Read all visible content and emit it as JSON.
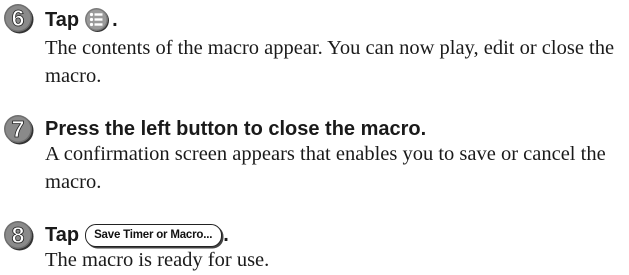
{
  "steps": [
    {
      "number": "6",
      "title_prefix": "Tap",
      "icon": "list-menu-icon",
      "title_suffix": ".",
      "description": "The contents of the macro appear. You can now play, edit or close the macro."
    },
    {
      "number": "7",
      "title": "Press the left button to close the macro.",
      "description": "A confirmation screen appears that enables you to save or cancel the macro."
    },
    {
      "number": "8",
      "title_prefix": "Tap",
      "button_label": "Save Timer or Macro...",
      "title_suffix": ".",
      "description": "The macro is ready for use."
    }
  ]
}
